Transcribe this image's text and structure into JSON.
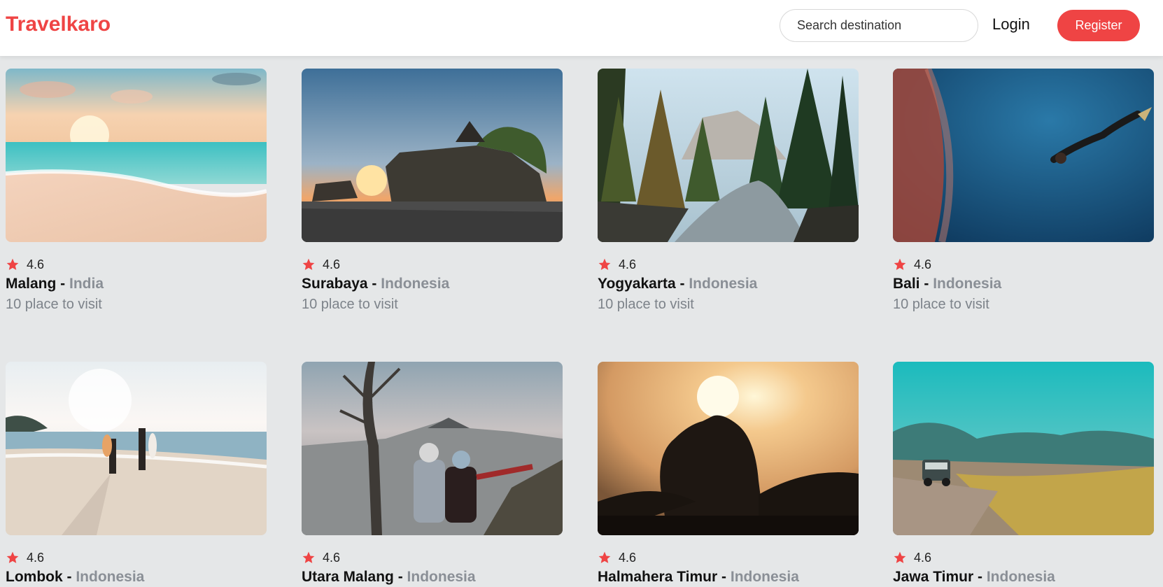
{
  "header": {
    "logo": "Travelkaro",
    "search_placeholder": "Search destination",
    "login_label": "Login",
    "register_label": "Register"
  },
  "colors": {
    "accent": "#ef4444",
    "background": "#e5e7e8",
    "muted": "#8a8f96"
  },
  "destinations": [
    {
      "city": "Malang",
      "separator": " - ",
      "country": "India",
      "rating": "4.6",
      "places": "10 place to visit",
      "image": "beach-sunset"
    },
    {
      "city": "Surabaya",
      "separator": " - ",
      "country": "Indonesia",
      "rating": "4.6",
      "places": "10 place to visit",
      "image": "temple-sunset"
    },
    {
      "city": "Yogyakarta",
      "separator": " - ",
      "country": "Indonesia",
      "rating": "4.6",
      "places": "10 place to visit",
      "image": "forest-river"
    },
    {
      "city": "Bali",
      "separator": " - ",
      "country": "Indonesia",
      "rating": "4.6",
      "places": "10 place to visit",
      "image": "underwater-diver"
    },
    {
      "city": "Lombok",
      "separator": " - ",
      "country": "Indonesia",
      "rating": "4.6",
      "places": "",
      "image": "beach-surfers"
    },
    {
      "city": "Utara Malang",
      "separator": " - ",
      "country": "Indonesia",
      "rating": "4.6",
      "places": "",
      "image": "mountain-hikers"
    },
    {
      "city": "Halmahera Timur",
      "separator": " - ",
      "country": "Indonesia",
      "rating": "4.6",
      "places": "",
      "image": "sunset-silhouette"
    },
    {
      "city": "Jawa Timur",
      "separator": " - ",
      "country": "Indonesia",
      "rating": "4.6",
      "places": "",
      "image": "jeep-valley"
    }
  ]
}
